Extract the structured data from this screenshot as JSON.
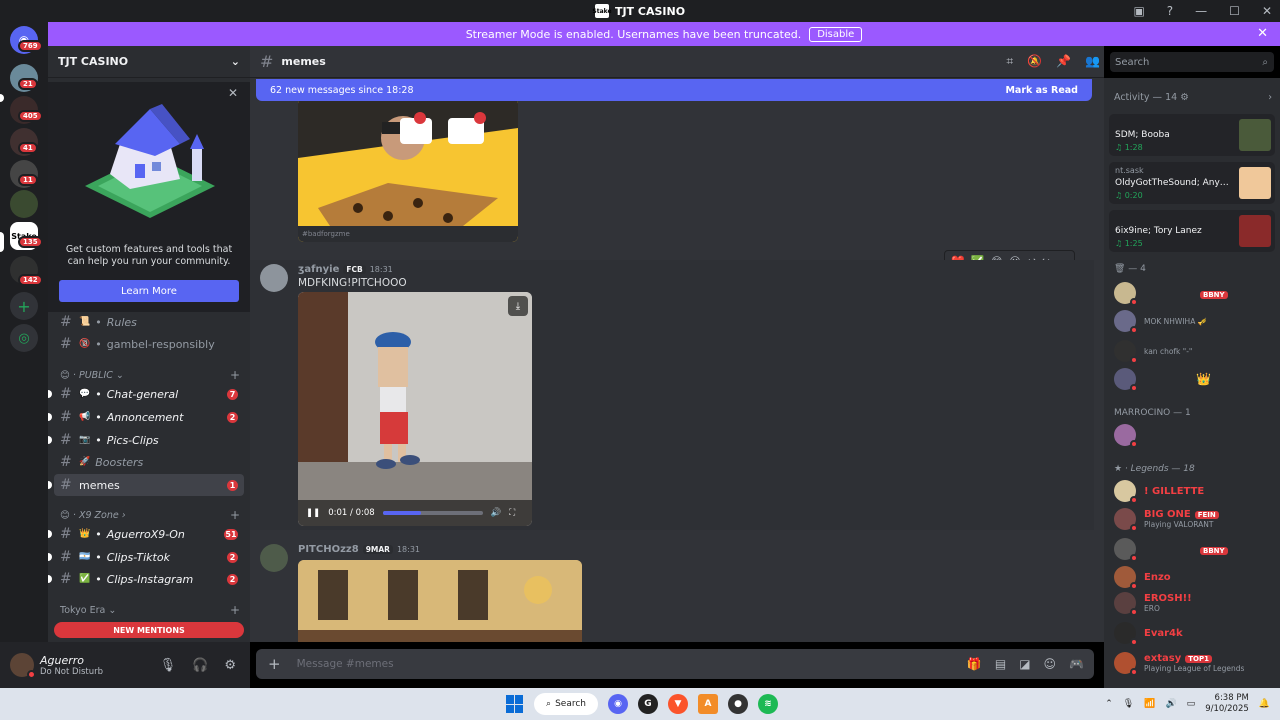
{
  "app": {
    "title": "TJT CASINO",
    "logo_text": "Stake"
  },
  "banner": {
    "text": "Streamer Mode is enabled. Usernames have been truncated.",
    "disable_label": "Disable"
  },
  "guild_badges": [
    "769",
    "21",
    "405",
    "41",
    "11",
    "135",
    "142"
  ],
  "server": {
    "name": "TJT CASINO"
  },
  "promo": {
    "text": "Get custom features and tools that can help you run your community.",
    "button": "Learn More"
  },
  "channels": [
    {
      "name": "Rules",
      "emoji": "📜"
    },
    {
      "name": "gambel-responsibly",
      "emoji": "🔞"
    },
    {
      "name": "Chat-general",
      "emoji": "💬",
      "badge": "7"
    },
    {
      "name": "Annoncement",
      "emoji": "📢",
      "badge": "2"
    },
    {
      "name": "Pics-Clips",
      "emoji": "📷"
    },
    {
      "name": "Boosters",
      "emoji": "🚀"
    },
    {
      "name": "memes",
      "badge": "1"
    },
    {
      "name": "AguerroX9-On",
      "emoji": "👑",
      "badge": "51"
    },
    {
      "name": "Clips-Tiktok",
      "emoji": "🇦🇷",
      "badge": "2"
    },
    {
      "name": "Clips-Instagram",
      "emoji": "✅",
      "badge": "2"
    }
  ],
  "categories": {
    "public": "PUBLIC",
    "x9": "X9 Zone",
    "tokyo": "Tokyo Era"
  },
  "new_mentions": "NEW MENTIONS",
  "user": {
    "name": "Aguerro",
    "status": "Do Not Disturb"
  },
  "channel_header": {
    "name": "memes"
  },
  "search": {
    "placeholder": "Search"
  },
  "new_messages_bar": {
    "text": "62 new messages since 18:28",
    "mark_read": "Mark as Read"
  },
  "messages": [
    {
      "author": "ʒafnyie",
      "tag": "FCB",
      "time": "18:31",
      "text": "MDFKING!PITCHOOO",
      "video_time": "0:01 / 0:08",
      "progress": 0.38
    },
    {
      "author": "PITCHOzz8",
      "tag": "9MAR",
      "time": "18:31"
    }
  ],
  "image_caption": "#badforgzme",
  "composer": {
    "placeholder": "Message #memes"
  },
  "activity": {
    "title": "Activity — 14",
    "cards": [
      {
        "line": "SDM; Booba",
        "time": "1:28",
        "user": ""
      },
      {
        "line": "OldyGotTheSound; Anys; S...",
        "time": "0:20",
        "user": "nt.sask"
      },
      {
        "line": "6ix9ine; Tory Lanez",
        "time": "1:25",
        "user": ""
      }
    ],
    "group1": "— 4",
    "group2": "MARROCINO — 1",
    "group3": "Legends — 18"
  },
  "members": [
    {
      "name": "",
      "badge": "BBNY",
      "sub": ""
    },
    {
      "name": "",
      "sub": "MOK NHWIHA 🎺"
    },
    {
      "name": "",
      "sub": "kan chofk \"-\""
    },
    {
      "name": "",
      "sub": ""
    },
    {
      "name": "",
      "sub": ""
    },
    {
      "name": "! GILLETTE",
      "sub": ""
    },
    {
      "name": "BIG ONE",
      "badge": "FEIN",
      "sub": "Playing VALORANT"
    },
    {
      "name": "",
      "badge": "BBNY",
      "sub": ""
    },
    {
      "name": "Enzo",
      "sub": ""
    },
    {
      "name": "EROSH!!",
      "sub": "ERO"
    },
    {
      "name": "Evar4k",
      "sub": ""
    },
    {
      "name": "extasy",
      "badge": "TOP1",
      "sub": "Playing League of Legends"
    }
  ],
  "taskbar": {
    "search": "Search",
    "time": "6:38 PM",
    "date": "9/10/2025"
  },
  "colors": {
    "accent": "#5865f2",
    "banner": "#9b59ff",
    "danger": "#da373c"
  }
}
